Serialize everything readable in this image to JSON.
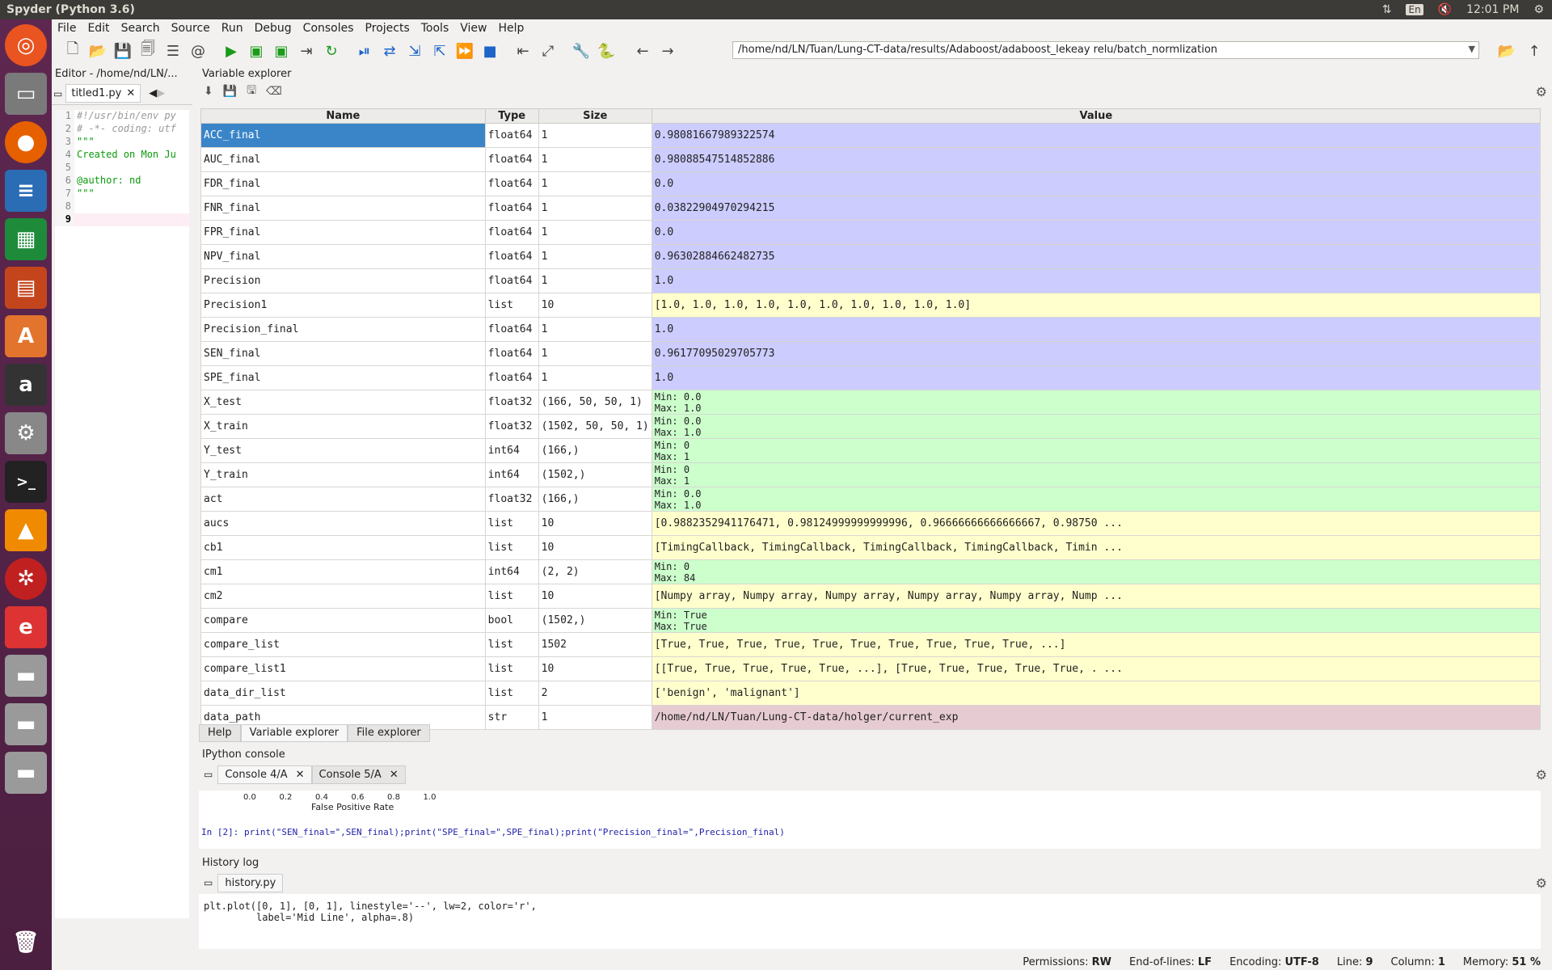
{
  "window": {
    "title": "Spyder (Python 3.6)"
  },
  "tray": {
    "lang": "En",
    "time": "12:01 PM"
  },
  "menu": [
    "File",
    "Edit",
    "Search",
    "Source",
    "Run",
    "Debug",
    "Consoles",
    "Projects",
    "Tools",
    "View",
    "Help"
  ],
  "path": "/home/nd/LN/Tuan/Lung-CT-data/results/Adaboost/adaboost_lekeay relu/batch_normlization",
  "editor": {
    "title": "Editor - /home/nd/LN/...",
    "tab": "titled1.py",
    "lines": [
      {
        "n": "1",
        "t": "#!/usr/bin/env py"
      },
      {
        "n": "2",
        "t": "# -*- coding: utf"
      },
      {
        "n": "3",
        "t": "\"\"\""
      },
      {
        "n": "4",
        "t": "Created on Mon Ju"
      },
      {
        "n": "5",
        "t": ""
      },
      {
        "n": "6",
        "t": "@author: nd"
      },
      {
        "n": "7",
        "t": "\"\"\""
      },
      {
        "n": "8",
        "t": ""
      },
      {
        "n": "9",
        "t": ""
      }
    ]
  },
  "variable_explorer": {
    "title": "Variable explorer",
    "headers": [
      "Name",
      "Type",
      "Size",
      "Value"
    ],
    "rows": [
      {
        "name": "ACC_final",
        "type": "float64",
        "size": "1",
        "value": "0.98081667989322574",
        "kind": "num"
      },
      {
        "name": "AUC_final",
        "type": "float64",
        "size": "1",
        "value": "0.98088547514852886",
        "kind": "num"
      },
      {
        "name": "FDR_final",
        "type": "float64",
        "size": "1",
        "value": "0.0",
        "kind": "num"
      },
      {
        "name": "FNR_final",
        "type": "float64",
        "size": "1",
        "value": "0.03822904970294215",
        "kind": "num"
      },
      {
        "name": "FPR_final",
        "type": "float64",
        "size": "1",
        "value": "0.0",
        "kind": "num"
      },
      {
        "name": "NPV_final",
        "type": "float64",
        "size": "1",
        "value": "0.96302884662482735",
        "kind": "num"
      },
      {
        "name": "Precision",
        "type": "float64",
        "size": "1",
        "value": "1.0",
        "kind": "num"
      },
      {
        "name": "Precision1",
        "type": "list",
        "size": "10",
        "value": "[1.0, 1.0, 1.0, 1.0, 1.0, 1.0, 1.0, 1.0, 1.0, 1.0]",
        "kind": "list"
      },
      {
        "name": "Precision_final",
        "type": "float64",
        "size": "1",
        "value": "1.0",
        "kind": "num"
      },
      {
        "name": "SEN_final",
        "type": "float64",
        "size": "1",
        "value": "0.96177095029705773",
        "kind": "num"
      },
      {
        "name": "SPE_final",
        "type": "float64",
        "size": "1",
        "value": "1.0",
        "kind": "num"
      },
      {
        "name": "X_test",
        "type": "float32",
        "size": "(166, 50, 50, 1)",
        "value": "Min: 0.0\nMax: 1.0",
        "kind": "arr"
      },
      {
        "name": "X_train",
        "type": "float32",
        "size": "(1502, 50, 50, 1)",
        "value": "Min: 0.0\nMax: 1.0",
        "kind": "arr"
      },
      {
        "name": "Y_test",
        "type": "int64",
        "size": "(166,)",
        "value": "Min: 0\nMax: 1",
        "kind": "arr"
      },
      {
        "name": "Y_train",
        "type": "int64",
        "size": "(1502,)",
        "value": "Min: 0\nMax: 1",
        "kind": "arr"
      },
      {
        "name": "act",
        "type": "float32",
        "size": "(166,)",
        "value": "Min: 0.0\nMax: 1.0",
        "kind": "arr"
      },
      {
        "name": "aucs",
        "type": "list",
        "size": "10",
        "value": "[0.9882352941176471, 0.98124999999999996, 0.96666666666666667, 0.98750 ...",
        "kind": "list"
      },
      {
        "name": "cb1",
        "type": "list",
        "size": "10",
        "value": "[TimingCallback, TimingCallback, TimingCallback, TimingCallback, Timin ...",
        "kind": "list"
      },
      {
        "name": "cm1",
        "type": "int64",
        "size": "(2, 2)",
        "value": "Min: 0\nMax: 84",
        "kind": "arr"
      },
      {
        "name": "cm2",
        "type": "list",
        "size": "10",
        "value": "[Numpy array, Numpy array, Numpy array, Numpy array, Numpy array, Nump ...",
        "kind": "list"
      },
      {
        "name": "compare",
        "type": "bool",
        "size": "(1502,)",
        "value": "Min: True\nMax: True",
        "kind": "arr"
      },
      {
        "name": "compare_list",
        "type": "list",
        "size": "1502",
        "value": "[True, True, True, True, True, True, True, True, True, True, ...]",
        "kind": "list"
      },
      {
        "name": "compare_list1",
        "type": "list",
        "size": "10",
        "value": "[[True, True, True, True, True, ...], [True, True, True, True, True, . ...",
        "kind": "list"
      },
      {
        "name": "data_dir_list",
        "type": "list",
        "size": "2",
        "value": "['benign', 'malignant']",
        "kind": "list"
      },
      {
        "name": "data_path",
        "type": "str",
        "size": "1",
        "value": "/home/nd/LN/Tuan/Lung-CT-data/holger/current_exp",
        "kind": "str"
      }
    ],
    "tabs": [
      "Help",
      "Variable explorer",
      "File explorer"
    ]
  },
  "console": {
    "title": "IPython console",
    "tabs": [
      "Console 4/A",
      "Console 5/A"
    ],
    "axis_ticks": "0.0         0.2         0.4         0.6         0.8         1.0",
    "axis_label": "False Positive Rate",
    "input": "In [2]: print(\"SEN_final=\",SEN_final);print(\"SPE_final=\",SPE_final);print(\"Precision_final=\",Precision_final)"
  },
  "history": {
    "title": "History log",
    "tab": "history.py",
    "line1": "plt.plot([0, 1], [0, 1], linestyle='--', lw=2, color='r',",
    "line2": "         label='Mid Line', alpha=.8)"
  },
  "status": {
    "permissions_label": "Permissions:",
    "permissions": "RW",
    "eol_label": "End-of-lines:",
    "eol": "LF",
    "encoding_label": "Encoding:",
    "encoding": "UTF-8",
    "line_label": "Line:",
    "line": "9",
    "column_label": "Column:",
    "column": "1",
    "memory_label": "Memory:",
    "memory": "51 %"
  }
}
